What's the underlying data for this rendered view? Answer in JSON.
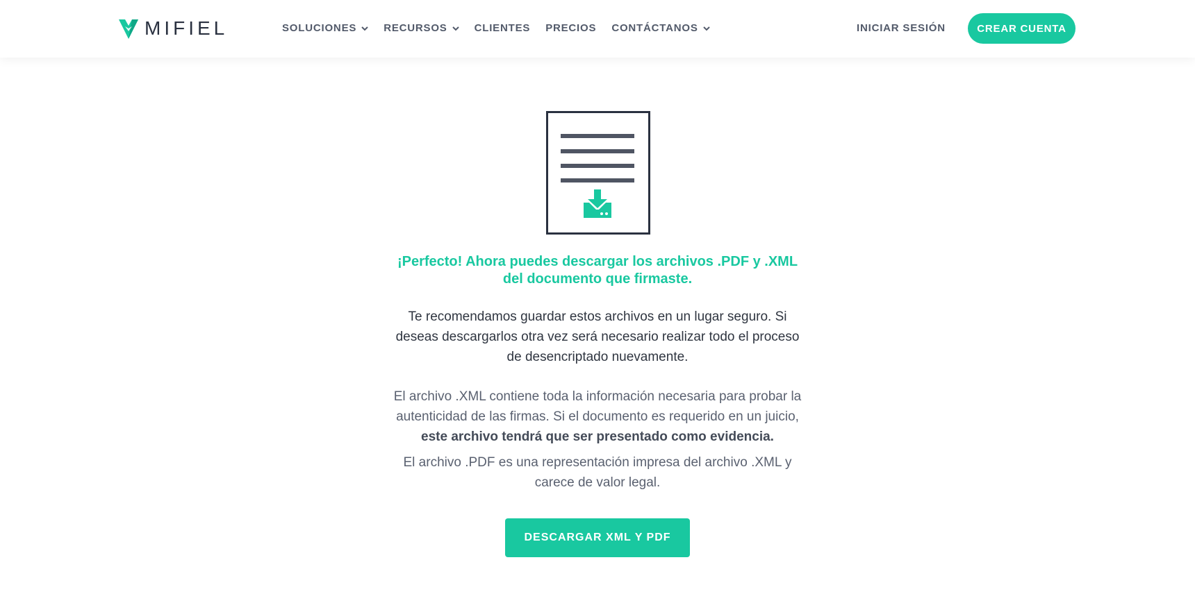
{
  "brand": {
    "name": "MIFIEL",
    "logo_icon": "mifiel-logo-icon",
    "accent_color": "#19c8a0"
  },
  "nav": {
    "items": [
      {
        "label": "SOLUCIONES",
        "has_dropdown": true
      },
      {
        "label": "RECURSOS",
        "has_dropdown": true
      },
      {
        "label": "CLIENTES",
        "has_dropdown": false
      },
      {
        "label": "PRECIOS",
        "has_dropdown": false
      },
      {
        "label": "CONTÁCTANOS",
        "has_dropdown": true
      }
    ],
    "login_label": "INICIAR SESIÓN",
    "signup_label": "CREAR CUENTA"
  },
  "main": {
    "icon": "document-download-icon",
    "headline": "¡Perfecto! Ahora puedes descargar los archivos .PDF y .XML del documento que firmaste.",
    "paragraph_1": "Te recomendamos guardar estos archivos en un lugar seguro. Si deseas descargarlos otra vez será necesario realizar todo el proceso de desencriptado nuevamente.",
    "paragraph_2_intro": "El archivo .XML contiene toda la información necesaria para probar la autenticidad de las firmas. Si el documento es requerido en un juicio,",
    "paragraph_2_strong": "este archivo tendrá que ser presentado como evidencia.",
    "paragraph_3": "El archivo .PDF es una representación impresa del archivo .XML y carece de valor legal.",
    "download_label": "DESCARGAR XML Y PDF"
  }
}
